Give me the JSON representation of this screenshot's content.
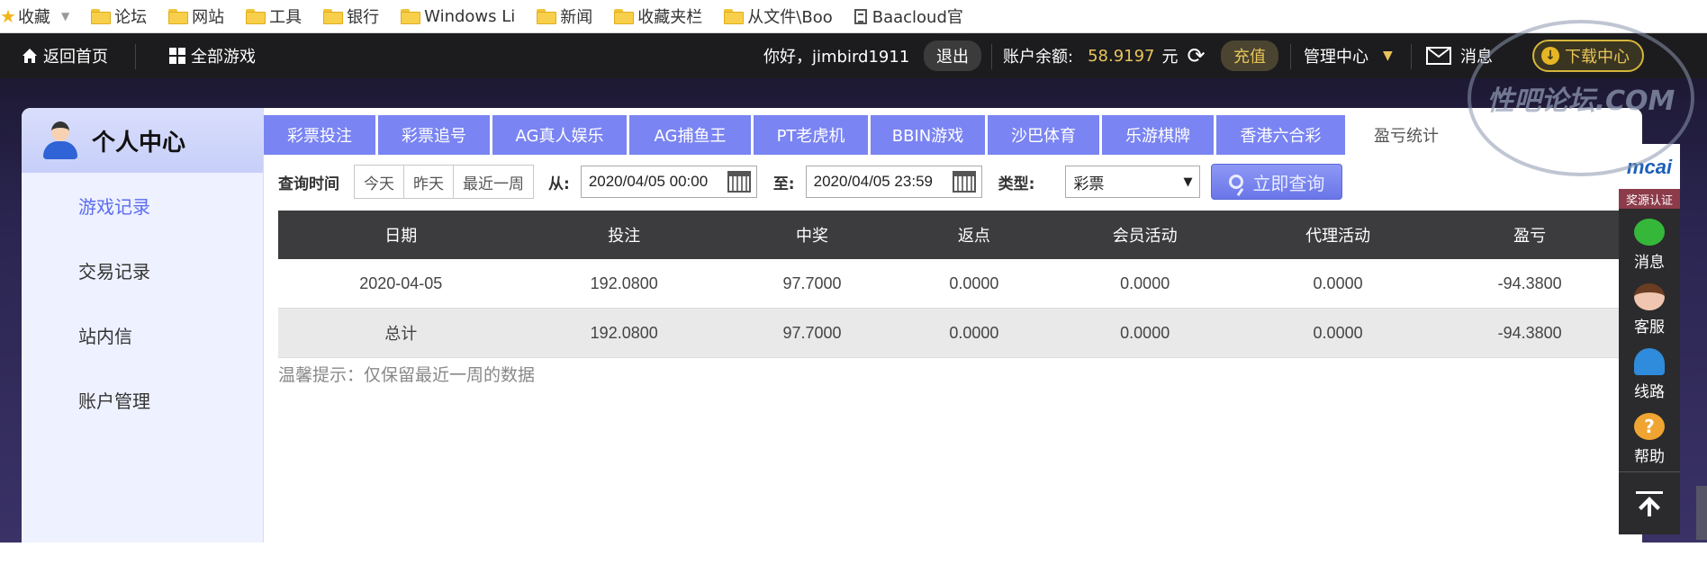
{
  "bookmarks": {
    "favorites_label": "收藏",
    "items": [
      "论坛",
      "网站",
      "工具",
      "银行",
      "Windows Li",
      "新闻",
      "收藏夹栏",
      "从文件\\Boo"
    ],
    "doc_item": "Baacloud官"
  },
  "topnav": {
    "home": "返回首页",
    "all_games": "全部游戏",
    "greeting": "你好，jimbird1911",
    "logout": "退出",
    "balance_label": "账户余额:",
    "balance_value": "58.9197",
    "balance_unit": "元",
    "recharge": "充值",
    "manage": "管理中心",
    "messages": "消息",
    "download": "下载中心"
  },
  "sidebar": {
    "title": "个人中心",
    "items": [
      {
        "label": "游戏记录",
        "active": true
      },
      {
        "label": "交易记录"
      },
      {
        "label": "站内信"
      },
      {
        "label": "账户管理"
      }
    ]
  },
  "tabs": [
    "彩票投注",
    "彩票追号",
    "AG真人娱乐",
    "AG捕鱼王",
    "PT老虎机",
    "BBIN游戏",
    "沙巴体育",
    "乐游棋牌",
    "香港六合彩",
    "盈亏统计"
  ],
  "active_tab": "盈亏统计",
  "query": {
    "time_label": "查询时间",
    "quick": [
      "今天",
      "昨天",
      "最近一周"
    ],
    "from_label": "从:",
    "from_value": "2020/04/05 00:00",
    "to_label": "至:",
    "to_value": "2020/04/05 23:59",
    "type_label": "类型:",
    "type_value": "彩票",
    "search_button": "立即查询"
  },
  "table": {
    "headers": [
      "日期",
      "投注",
      "中奖",
      "返点",
      "会员活动",
      "代理活动",
      "盈亏"
    ],
    "rows": [
      [
        "2020-04-05",
        "192.0800",
        "97.7000",
        "0.0000",
        "0.0000",
        "0.0000",
        "-94.3800"
      ],
      [
        "总计",
        "192.0800",
        "97.7000",
        "0.0000",
        "0.0000",
        "0.0000",
        "-94.3800"
      ]
    ]
  },
  "tip": "温馨提示：仅保留最近一周的数据",
  "right_bar": {
    "brand": "mcai",
    "badge": "奖源认证",
    "items": [
      "消息",
      "客服",
      "线路",
      "帮助"
    ]
  },
  "watermark": "性吧论坛.COM"
}
